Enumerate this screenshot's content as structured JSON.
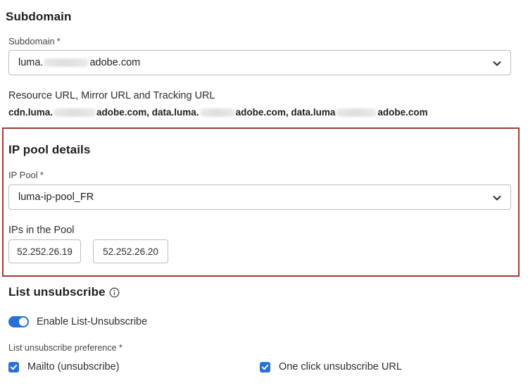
{
  "subdomain": {
    "title": "Subdomain",
    "field_label": "Subdomain",
    "required_marker": "*",
    "value_prefix": "luma.",
    "value_suffix": "adobe.com"
  },
  "resource_urls": {
    "label": "Resource URL, Mirror URL and Tracking URL",
    "url1_prefix": "cdn.luma.",
    "url1_suffix": "adobe.com,",
    "url2_prefix": "data.luma.",
    "url2_suffix": "adobe.com,",
    "url3_prefix": "data.luma",
    "url3_suffix": "adobe.com"
  },
  "ip_pool": {
    "title": "IP pool details",
    "field_label": "IP Pool",
    "required_marker": "*",
    "selected": "luma-ip-pool_FR",
    "ips_label": "IPs in the Pool",
    "ips": [
      "52.252.26.19",
      "52.252.26.20"
    ]
  },
  "list_unsubscribe": {
    "title": "List unsubscribe",
    "info_icon": "info-icon",
    "toggle_label": "Enable List-Unsubscribe",
    "toggle_on": true,
    "preference_label": "List unsubscribe preference *",
    "options": [
      {
        "label": "Mailto (unsubscribe)",
        "checked": true
      },
      {
        "label": "One click unsubscribe URL",
        "checked": true
      }
    ]
  },
  "colors": {
    "accent": "#2a71d5",
    "highlight_border": "#a33a34"
  }
}
